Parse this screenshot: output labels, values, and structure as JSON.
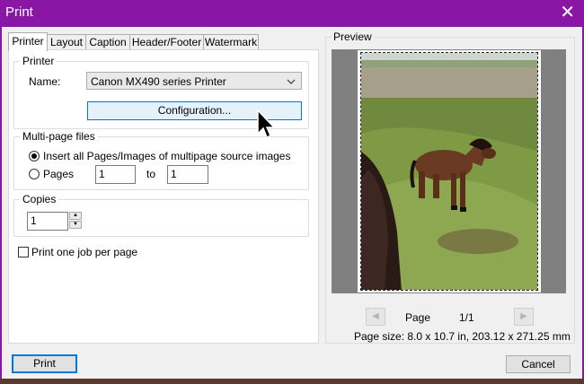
{
  "window": {
    "title": "Print",
    "close_glyph": "✕"
  },
  "tabs": [
    {
      "label": "Printer",
      "active": true
    },
    {
      "label": "Layout"
    },
    {
      "label": "Caption"
    },
    {
      "label": "Header/Footer"
    },
    {
      "label": "Watermark"
    }
  ],
  "printer": {
    "group_label": "Printer",
    "name_label": "Name:",
    "selected_printer": "Canon MX490 series Printer",
    "configuration_button": "Configuration..."
  },
  "multipage": {
    "group_label": "Multi-page files",
    "option_insert_all": "Insert all Pages/Images of multipage source images",
    "option_pages": "Pages",
    "from_value": "1",
    "to_label": "to",
    "to_value": "1",
    "selected": "insert_all"
  },
  "copies": {
    "group_label": "Copies",
    "value": "1"
  },
  "one_job": {
    "label": "Print one job per page",
    "checked": false
  },
  "preview": {
    "group_label": "Preview",
    "page_label": "Page",
    "page_counter": "1/1",
    "page_size": "Page size: 8.0 x 10.7 in, 203.12 x 271.25 mm"
  },
  "footer": {
    "print_button": "Print",
    "cancel_button": "Cancel"
  },
  "colors": {
    "titlebar": "#8a16a6",
    "accent": "#0078d7"
  }
}
